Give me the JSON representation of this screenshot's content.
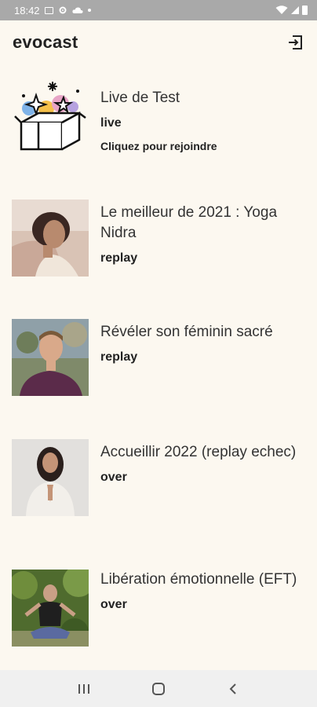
{
  "status_bar": {
    "time": "18:42"
  },
  "app": {
    "title": "evocast"
  },
  "items": [
    {
      "title": "Live de Test",
      "status": "live",
      "action": "Cliquez pour rejoindre",
      "thumb_icon": "gift-box-illustration-icon"
    },
    {
      "title": "Le meilleur de 2021 : Yoga Nidra",
      "status": "replay",
      "thumb_icon": "woman-portrait-photo"
    },
    {
      "title": "Révéler son féminin sacré",
      "status": "replay",
      "thumb_icon": "man-portrait-photo"
    },
    {
      "title": "Accueillir 2022 (replay echec)",
      "status": "over",
      "thumb_icon": "woman-praying-photo"
    },
    {
      "title": "Libération émotionnelle (EFT)",
      "status": "over",
      "thumb_icon": "man-meditating-photo"
    }
  ],
  "icons": {
    "exit": "logout-icon",
    "nav_recent": "recent-apps-icon",
    "nav_home": "home-icon",
    "nav_back": "back-icon"
  },
  "colors": {
    "background": "#fcf8f0",
    "status_bar": "#a9a9a9",
    "nav_bar": "#f0f0f0"
  }
}
